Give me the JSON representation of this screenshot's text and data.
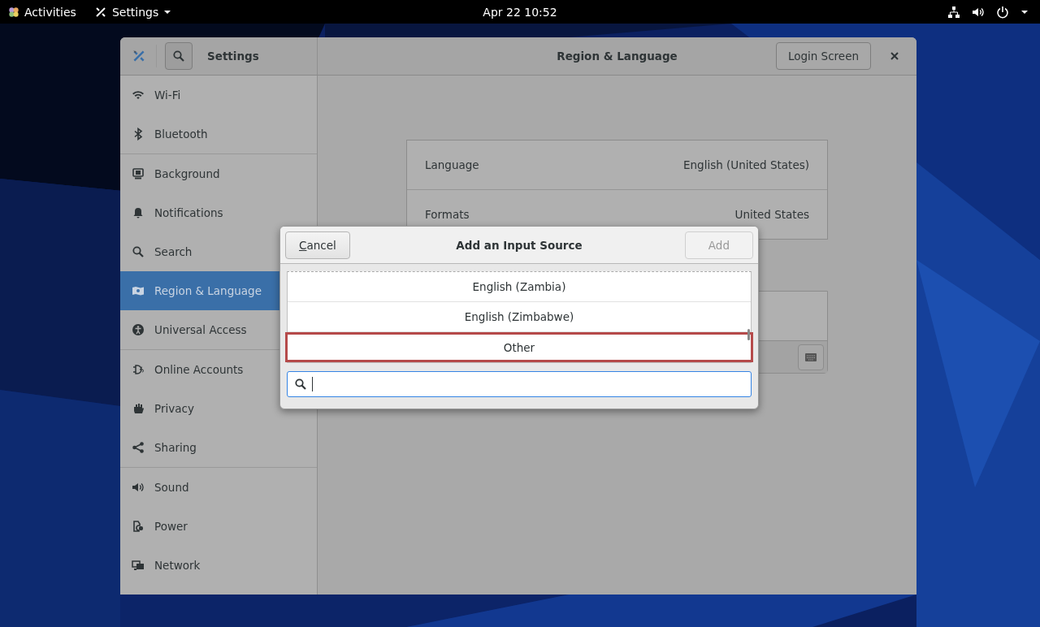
{
  "top_bar": {
    "activities": "Activities",
    "app_menu": "Settings",
    "clock": "Apr 22 10:52"
  },
  "window": {
    "title": "Settings",
    "page_title": "Region & Language",
    "login_button": "Login Screen"
  },
  "sidebar": {
    "groups": [
      [
        {
          "label": "Wi-Fi",
          "selected": false
        },
        {
          "label": "Bluetooth",
          "selected": false
        }
      ],
      [
        {
          "label": "Background",
          "selected": false
        },
        {
          "label": "Notifications",
          "selected": false
        },
        {
          "label": "Search",
          "selected": false
        },
        {
          "label": "Region & Language",
          "selected": true
        },
        {
          "label": "Universal Access",
          "selected": false
        }
      ],
      [
        {
          "label": "Online Accounts",
          "selected": false
        },
        {
          "label": "Privacy",
          "selected": false
        },
        {
          "label": "Sharing",
          "selected": false
        }
      ],
      [
        {
          "label": "Sound",
          "selected": false
        },
        {
          "label": "Power",
          "selected": false
        },
        {
          "label": "Network",
          "selected": false
        }
      ]
    ]
  },
  "settings": {
    "rows": [
      {
        "label": "Language",
        "value": "English (United States)"
      },
      {
        "label": "Formats",
        "value": "United States"
      }
    ]
  },
  "dialog": {
    "title": "Add an Input Source",
    "cancel": "Cancel",
    "add": {
      "label": "Add",
      "disabled": true
    },
    "items": [
      {
        "label": "English (Zambia)",
        "selected": false
      },
      {
        "label": "English (Zimbabwe)",
        "selected": false
      },
      {
        "label": "Other",
        "selected": true
      }
    ]
  }
}
